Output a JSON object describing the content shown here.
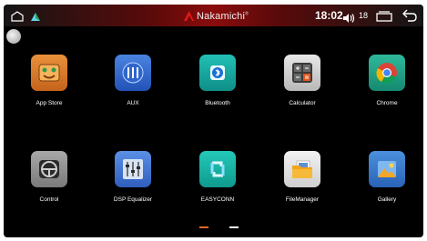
{
  "status_bar": {
    "brand": "Nakamichi",
    "brand_mark": "®",
    "time": "18:02",
    "volume": "18",
    "accent_color": "#b01010"
  },
  "apps": [
    {
      "label": "App Store",
      "icon": "app-store-icon",
      "color": "#d97a2a"
    },
    {
      "label": "AUX",
      "icon": "aux-icon",
      "color": "#2f63c9"
    },
    {
      "label": "Bluetooth",
      "icon": "bluetooth-icon",
      "color": "#15a7a0"
    },
    {
      "label": "Calculator",
      "icon": "calculator-icon",
      "color": "#d0d0d0"
    },
    {
      "label": "Chrome",
      "icon": "chrome-icon",
      "color": "#1aa38a"
    },
    {
      "label": "Control",
      "icon": "steering-wheel-icon",
      "color": "#9a9a9a"
    },
    {
      "label": "DSP Equalizer",
      "icon": "equalizer-icon",
      "color": "#3f7ad6"
    },
    {
      "label": "EASYCONN",
      "icon": "easyconn-icon",
      "color": "#18b5a7"
    },
    {
      "label": "FileManager",
      "icon": "folder-icon",
      "color": "#e0e0e0"
    },
    {
      "label": "Gallery",
      "icon": "gallery-icon",
      "color": "#3a7fd0"
    }
  ],
  "pager": {
    "pages": 2,
    "current": 1,
    "active_color": "#e2652f"
  }
}
